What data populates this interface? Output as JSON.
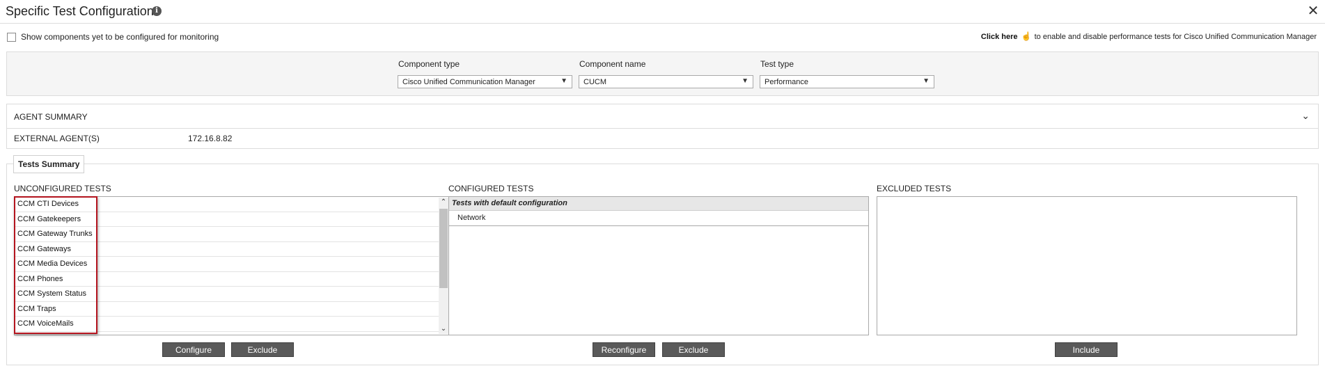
{
  "dialog": {
    "title": "Specific Test Configuration",
    "info_icon": "i",
    "close_icon": "✕"
  },
  "options": {
    "show_unconfigured_label": "Show components yet to be configured for monitoring",
    "show_unconfigured_checked": false,
    "click_here_label": "Click here",
    "click_here_suffix": "to enable and disable performance tests for Cisco Unified Communication Manager"
  },
  "filters": {
    "component_type": {
      "label": "Component type",
      "value": "Cisco Unified Communication Manager"
    },
    "component_name": {
      "label": "Component name",
      "value": "CUCM"
    },
    "test_type": {
      "label": "Test type",
      "value": "Performance"
    },
    "chevron": "⌄"
  },
  "agent_summary": {
    "title": "AGENT SUMMARY",
    "chevron": "⌄",
    "external_agents_label": "EXTERNAL AGENT(S)",
    "external_agents_value": "172.16.8.82"
  },
  "tests_summary": {
    "tab_label": "Tests Summary",
    "unconfigured": {
      "header": "UNCONFIGURED TESTS",
      "items": [
        "CCM CTI Devices",
        "CCM Gatekeepers",
        "CCM Gateway Trunks",
        "CCM Gateways",
        "CCM Media Devices",
        "CCM Phones",
        "CCM System Status",
        "CCM Traps",
        "CCM VoiceMails"
      ],
      "buttons": {
        "configure": "Configure",
        "exclude": "Exclude"
      }
    },
    "configured": {
      "header": "CONFIGURED TESTS",
      "group_label": "Tests with default configuration",
      "items": [
        "Network"
      ],
      "buttons": {
        "reconfigure": "Reconfigure",
        "exclude": "Exclude"
      }
    },
    "excluded": {
      "header": "EXCLUDED TESTS",
      "items": [],
      "buttons": {
        "include": "Include"
      }
    }
  },
  "colors": {
    "highlight_border": "#b4141e",
    "button_bg": "#5a5a5a"
  }
}
